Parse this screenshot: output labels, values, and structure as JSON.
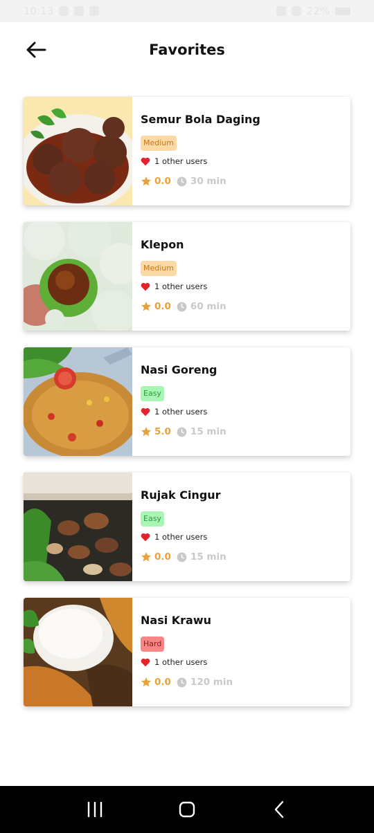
{
  "status_bar": {
    "time": "10:13",
    "battery": "22%"
  },
  "header": {
    "title": "Favorites",
    "back_icon": "arrow-left-icon"
  },
  "colors": {
    "medium_bg": "#fcd9a5",
    "medium_text": "#c5761a",
    "easy_bg": "#a8f5b4",
    "easy_text": "#2f9a3e",
    "hard_bg": "#f88686",
    "hard_text": "#8a1a1a",
    "heart": "#e5222b",
    "star": "#e9a23b",
    "clock": "#c9c9c9"
  },
  "recipes": [
    {
      "title": "Semur Bola Daging",
      "difficulty": "Medium",
      "likes": "1 other users",
      "rating": "0.0",
      "duration": "30 min"
    },
    {
      "title": "Klepon",
      "difficulty": "Medium",
      "likes": "1 other users",
      "rating": "0.0",
      "duration": "60 min"
    },
    {
      "title": "Nasi Goreng",
      "difficulty": "Easy",
      "likes": "1 other users",
      "rating": "5.0",
      "duration": "15 min"
    },
    {
      "title": "Rujak Cingur",
      "difficulty": "Easy",
      "likes": "1 other users",
      "rating": "0.0",
      "duration": "15 min"
    },
    {
      "title": "Nasi Krawu",
      "difficulty": "Hard",
      "likes": "1 other users",
      "rating": "0.0",
      "duration": "120 min"
    }
  ],
  "nav": {
    "recents_icon": "recents-icon",
    "home_icon": "home-icon",
    "back_icon": "back-chevron-icon"
  }
}
